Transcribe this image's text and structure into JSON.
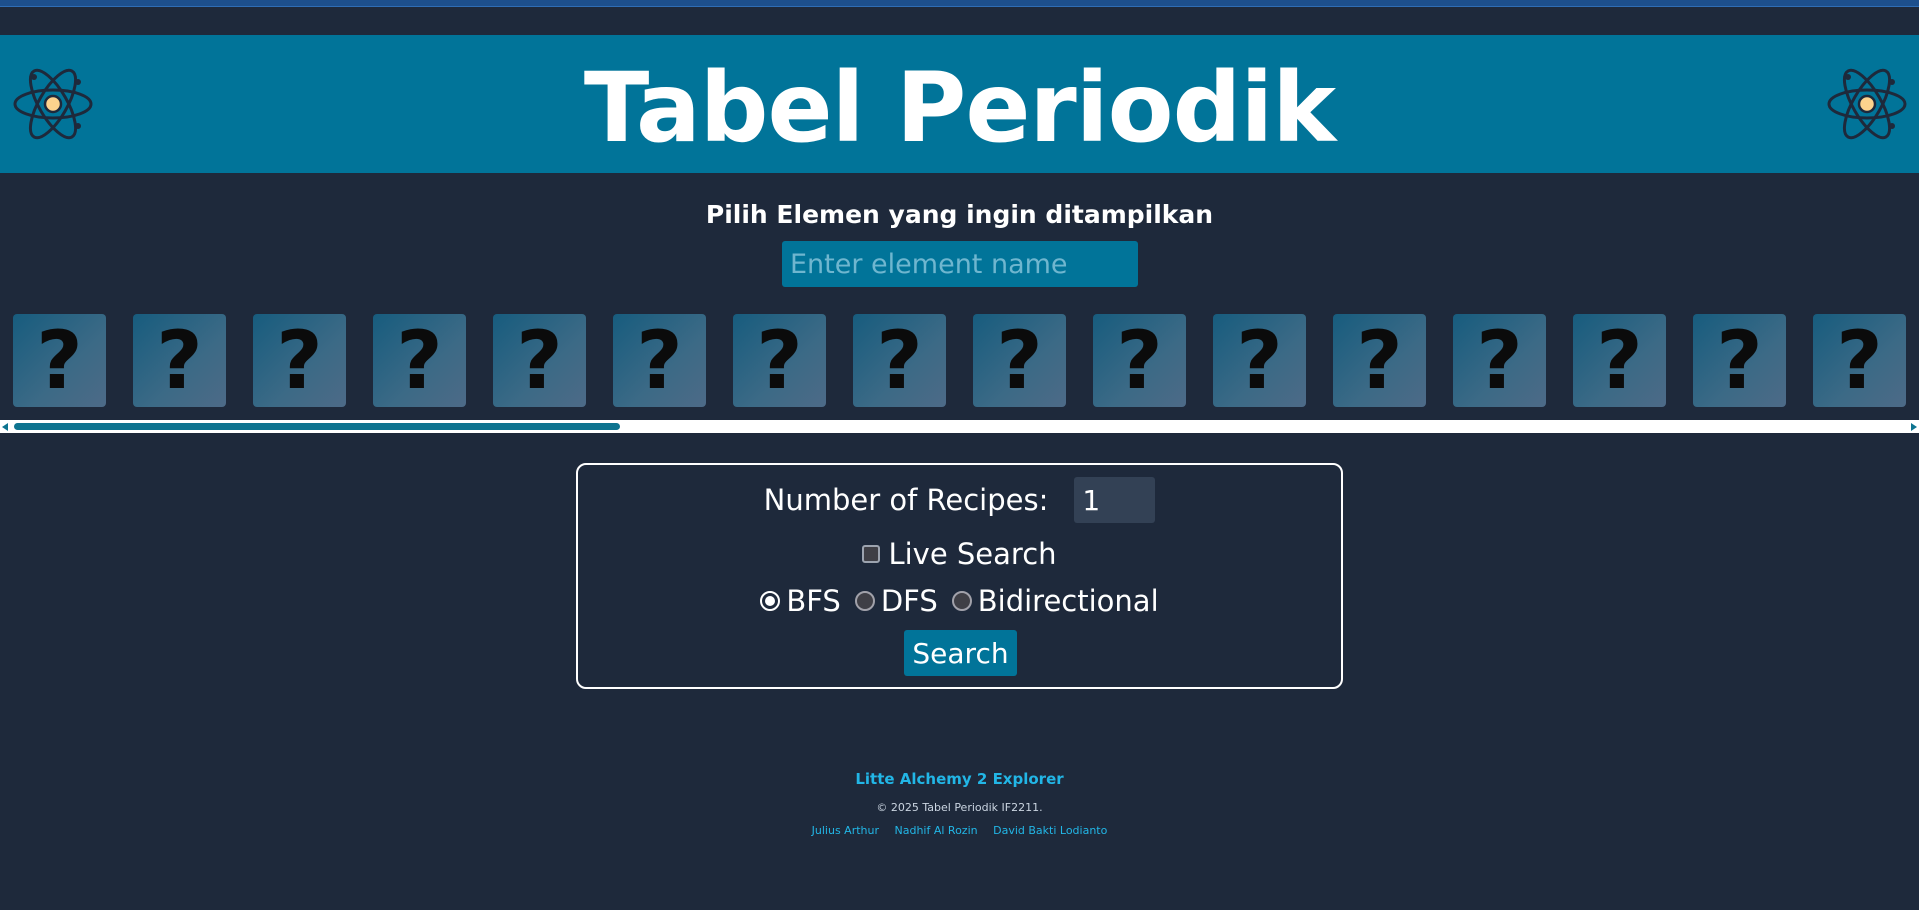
{
  "header": {
    "title": "Tabel Periodik",
    "left_icon": "atom-icon",
    "right_icon": "atom-icon"
  },
  "selector": {
    "subtitle": "Pilih Elemen yang ingin ditampilkan",
    "search_placeholder": "Enter element name",
    "cards": [
      "?",
      "?",
      "?",
      "?",
      "?",
      "?",
      "?",
      "?",
      "?",
      "?",
      "?",
      "?",
      "?",
      "?",
      "?",
      "?"
    ]
  },
  "form": {
    "recipes_label": "Number of Recipes:",
    "recipes_value": "1",
    "live_search_label": "Live Search",
    "live_search_checked": false,
    "algorithms": [
      {
        "label": "BFS",
        "checked": true
      },
      {
        "label": "DFS",
        "checked": false
      },
      {
        "label": "Bidirectional",
        "checked": false
      }
    ],
    "search_button": "Search"
  },
  "footer": {
    "title": "Litte Alchemy 2 Explorer",
    "copyright": "© 2025 Tabel Periodik IF2211.",
    "authors": [
      "Julius Arthur",
      "Nadhif Al Rozin",
      "David Bakti Lodianto"
    ]
  },
  "colors": {
    "background": "#1e293b",
    "header": "#017499",
    "accent": "#22b6e6"
  }
}
